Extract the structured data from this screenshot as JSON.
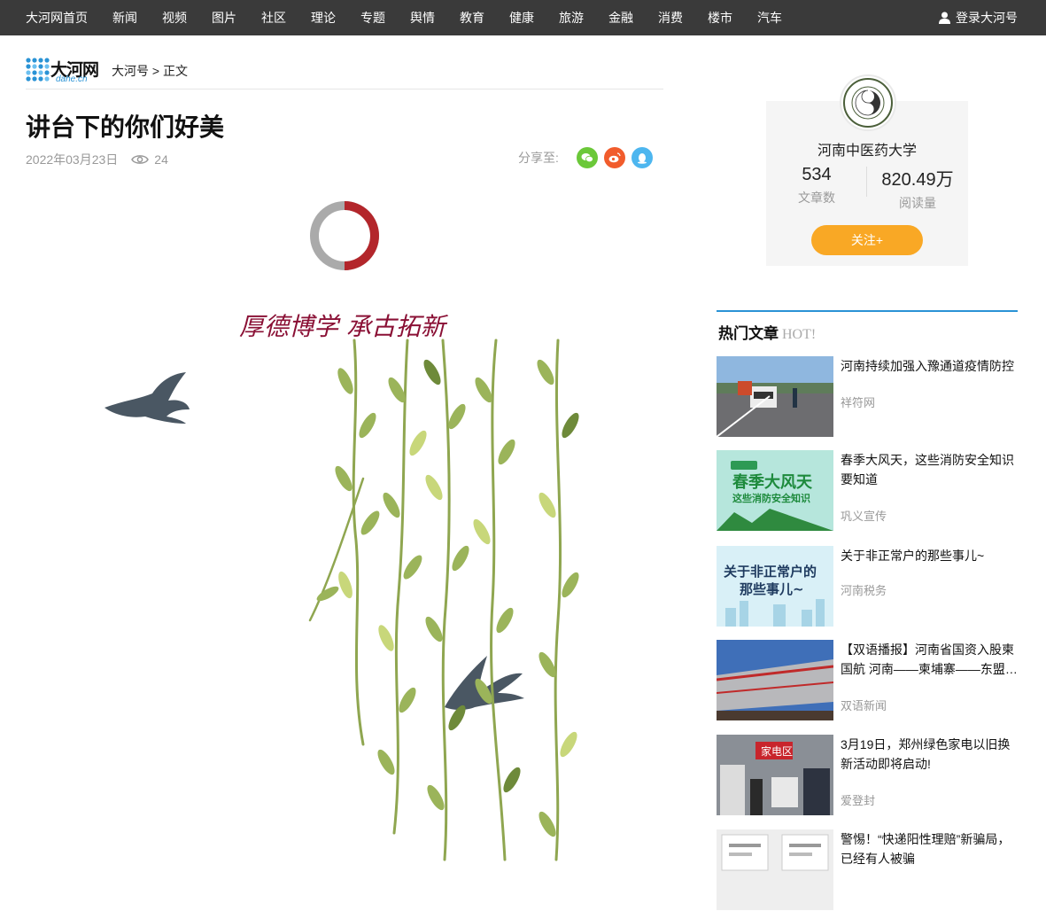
{
  "nav": {
    "items": [
      "大河网首页",
      "新闻",
      "视频",
      "图片",
      "社区",
      "理论",
      "专题",
      "舆情",
      "教育",
      "健康",
      "旅游",
      "金融",
      "消费",
      "楼市",
      "汽车"
    ],
    "login": "登录大河号"
  },
  "logo": {
    "name": "大河网",
    "domain": "dahe.cn"
  },
  "breadcrumb": "大河号 > 正文",
  "article": {
    "title": "讲台下的你们好美",
    "date": "2022年03月23日",
    "views": "24",
    "share_label": "分享至:",
    "art_caption": "厚德博学 承古拓新"
  },
  "profile": {
    "name": "河南中医药大学",
    "articles_count": "534",
    "articles_label": "文章数",
    "reads_count": "820.49万",
    "reads_label": "阅读量",
    "follow": "关注+"
  },
  "hot": {
    "title": "热门文章",
    "title_en": "HOT!",
    "items": [
      {
        "title": "河南持续加强入豫通道疫情防控",
        "source": "祥符网"
      },
      {
        "title": "春季大风天，这些消防安全知识要知道",
        "source": "巩义宣传",
        "thumb_text": "春季大风天",
        "thumb_sub": "这些消防安全知识"
      },
      {
        "title": "关于非正常户的那些事儿~",
        "source": "河南税务",
        "thumb_text": "关于非正常户的",
        "thumb_sub": "那些事儿~"
      },
      {
        "title": "【双语播报】河南省国资入股柬国航 河南——柬埔寨——东盟…",
        "source": "双语新闻"
      },
      {
        "title": "3月19日，郑州绿色家电以旧换新活动即将启动!",
        "source": "爱登封",
        "thumb_text": "家电区"
      },
      {
        "title": "警惕！“快递阳性理赔”新骗局，已经有人被骗",
        "source": ""
      }
    ]
  },
  "colors": {
    "nav_bg": "#3a3a3a",
    "accent": "#2a93d5",
    "follow": "#f9a825",
    "wechat": "#6bc839",
    "weibo": "#f15c2c",
    "qq": "#4db6ef"
  }
}
